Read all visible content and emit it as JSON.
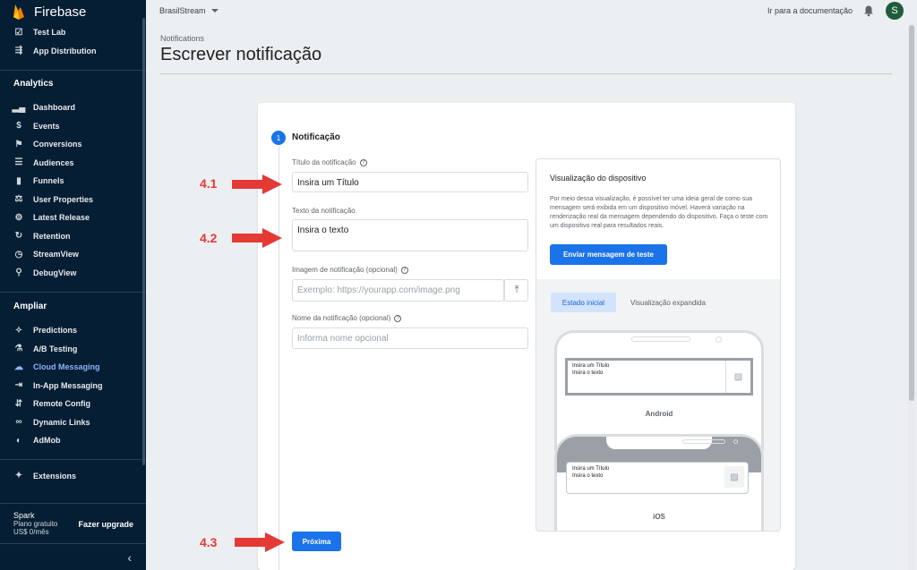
{
  "sidebar": {
    "brand": "Firebase",
    "top_items": [
      {
        "label": "Test Lab",
        "icon": "checklist-icon"
      },
      {
        "label": "App Distribution",
        "icon": "app-distribution-icon"
      }
    ],
    "analytics_title": "Analytics",
    "analytics_items": [
      {
        "label": "Dashboard",
        "icon": "bar-chart-icon"
      },
      {
        "label": "Events",
        "icon": "events-icon"
      },
      {
        "label": "Conversions",
        "icon": "flag-icon"
      },
      {
        "label": "Audiences",
        "icon": "audiences-icon"
      },
      {
        "label": "Funnels",
        "icon": "funnel-icon"
      },
      {
        "label": "User Properties",
        "icon": "user-properties-icon"
      },
      {
        "label": "Latest Release",
        "icon": "latest-release-icon"
      },
      {
        "label": "Retention",
        "icon": "retention-icon"
      },
      {
        "label": "StreamView",
        "icon": "clock-icon"
      },
      {
        "label": "DebugView",
        "icon": "debug-icon"
      }
    ],
    "ampliar_title": "Ampliar",
    "ampliar_items": [
      {
        "label": "Predictions",
        "icon": "wand-icon"
      },
      {
        "label": "A/B Testing",
        "icon": "flask-icon"
      },
      {
        "label": "Cloud Messaging",
        "icon": "cloud-messaging-icon"
      },
      {
        "label": "In-App Messaging",
        "icon": "in-app-messaging-icon"
      },
      {
        "label": "Remote Config",
        "icon": "remote-config-icon"
      },
      {
        "label": "Dynamic Links",
        "icon": "link-icon"
      },
      {
        "label": "AdMob",
        "icon": "admob-icon"
      }
    ],
    "active_item": "Cloud Messaging",
    "extensions": "Extensions",
    "plan_name": "Spark",
    "plan_type": "Plano gratuito",
    "plan_price": "US$ 0/mês",
    "upgrade": "Fazer upgrade"
  },
  "topbar": {
    "project": "BrasilStream",
    "docs": "Ir para a documentação",
    "avatar_letter": "S"
  },
  "header": {
    "breadcrumb": "Notifications",
    "title": "Escrever notificação"
  },
  "form": {
    "step_number": "1",
    "step_title": "Notificação",
    "title_label": "Título da notificação",
    "title_value": "Insira um Título",
    "text_label": "Texto da notificação",
    "text_value": "Insira o texto",
    "image_label": "Imagem de notificação (opcional)",
    "image_placeholder": "Exemplo: https://yourapp.com/image.png",
    "name_label": "Nome da notificação (opcional)",
    "name_placeholder": "Informa nome opcional",
    "next_button": "Próxima"
  },
  "preview": {
    "title": "Visualização do dispositivo",
    "description": "Por meio dessa visualização, é possível ter uma ideia geral de como sua mensagem será exibida em um dispositivo móvel. Haverá variação na renderização real da mensagem dependendo do dispositivo. Faça o teste com um dispositivo real para resultados reais.",
    "test_button": "Enviar mensagem de teste",
    "tab_initial": "Estado inicial",
    "tab_expanded": "Visualização expandida",
    "notif_title": "Insira um Título",
    "notif_body": "Insira o texto",
    "android_label": "Android",
    "ios_label": "iOS"
  },
  "annotations": {
    "a1": "4.1",
    "a2": "4.2",
    "a3": "4.3"
  },
  "colors": {
    "sidebar_bg": "#051e34",
    "accent": "#1a73e8",
    "annotation": "#e53935"
  }
}
